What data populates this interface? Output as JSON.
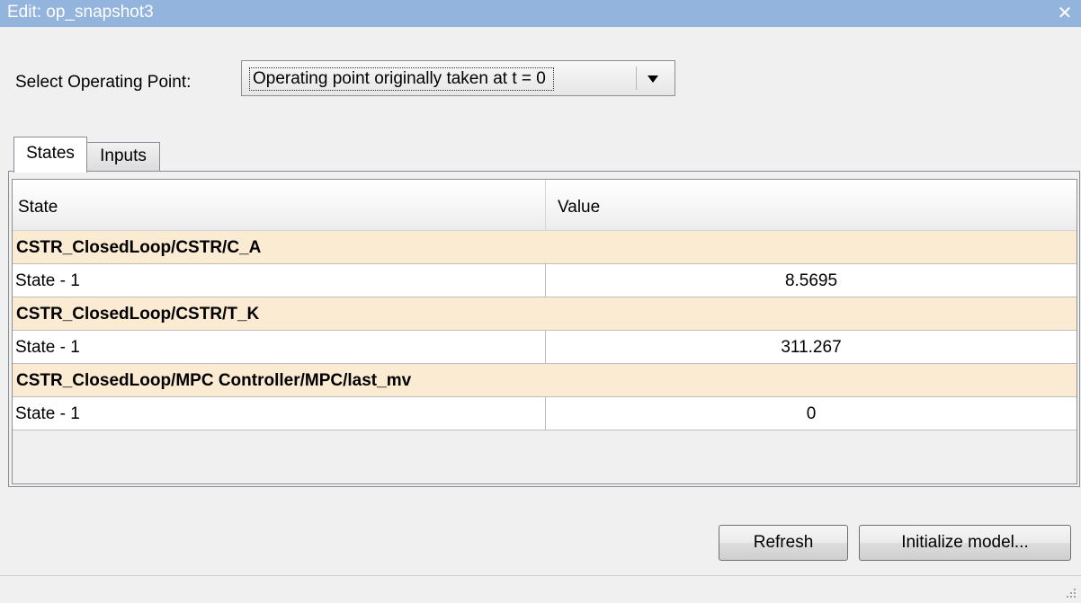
{
  "window": {
    "title": "Edit: op_snapshot3",
    "close_icon": "close-icon"
  },
  "operating_point": {
    "label": "Select Operating Point:",
    "selected": "Operating point originally taken at t = 0"
  },
  "tabs": [
    {
      "label": "States",
      "active": true
    },
    {
      "label": "Inputs",
      "active": false
    }
  ],
  "table": {
    "columns": [
      "State",
      "Value"
    ],
    "groups": [
      {
        "block": "CSTR_ClosedLoop/CSTR/C_A",
        "rows": [
          {
            "state": "State - 1",
            "value": "8.5695"
          }
        ]
      },
      {
        "block": "CSTR_ClosedLoop/CSTR/T_K",
        "rows": [
          {
            "state": "State - 1",
            "value": "311.267"
          }
        ]
      },
      {
        "block": "CSTR_ClosedLoop/MPC Controller/MPC/last_mv",
        "rows": [
          {
            "state": "State - 1",
            "value": "0"
          }
        ]
      }
    ]
  },
  "buttons": {
    "refresh": "Refresh",
    "initialize": "Initialize model..."
  },
  "colors": {
    "titlebar": "#92b4dd",
    "group_row": "#faebd2"
  }
}
